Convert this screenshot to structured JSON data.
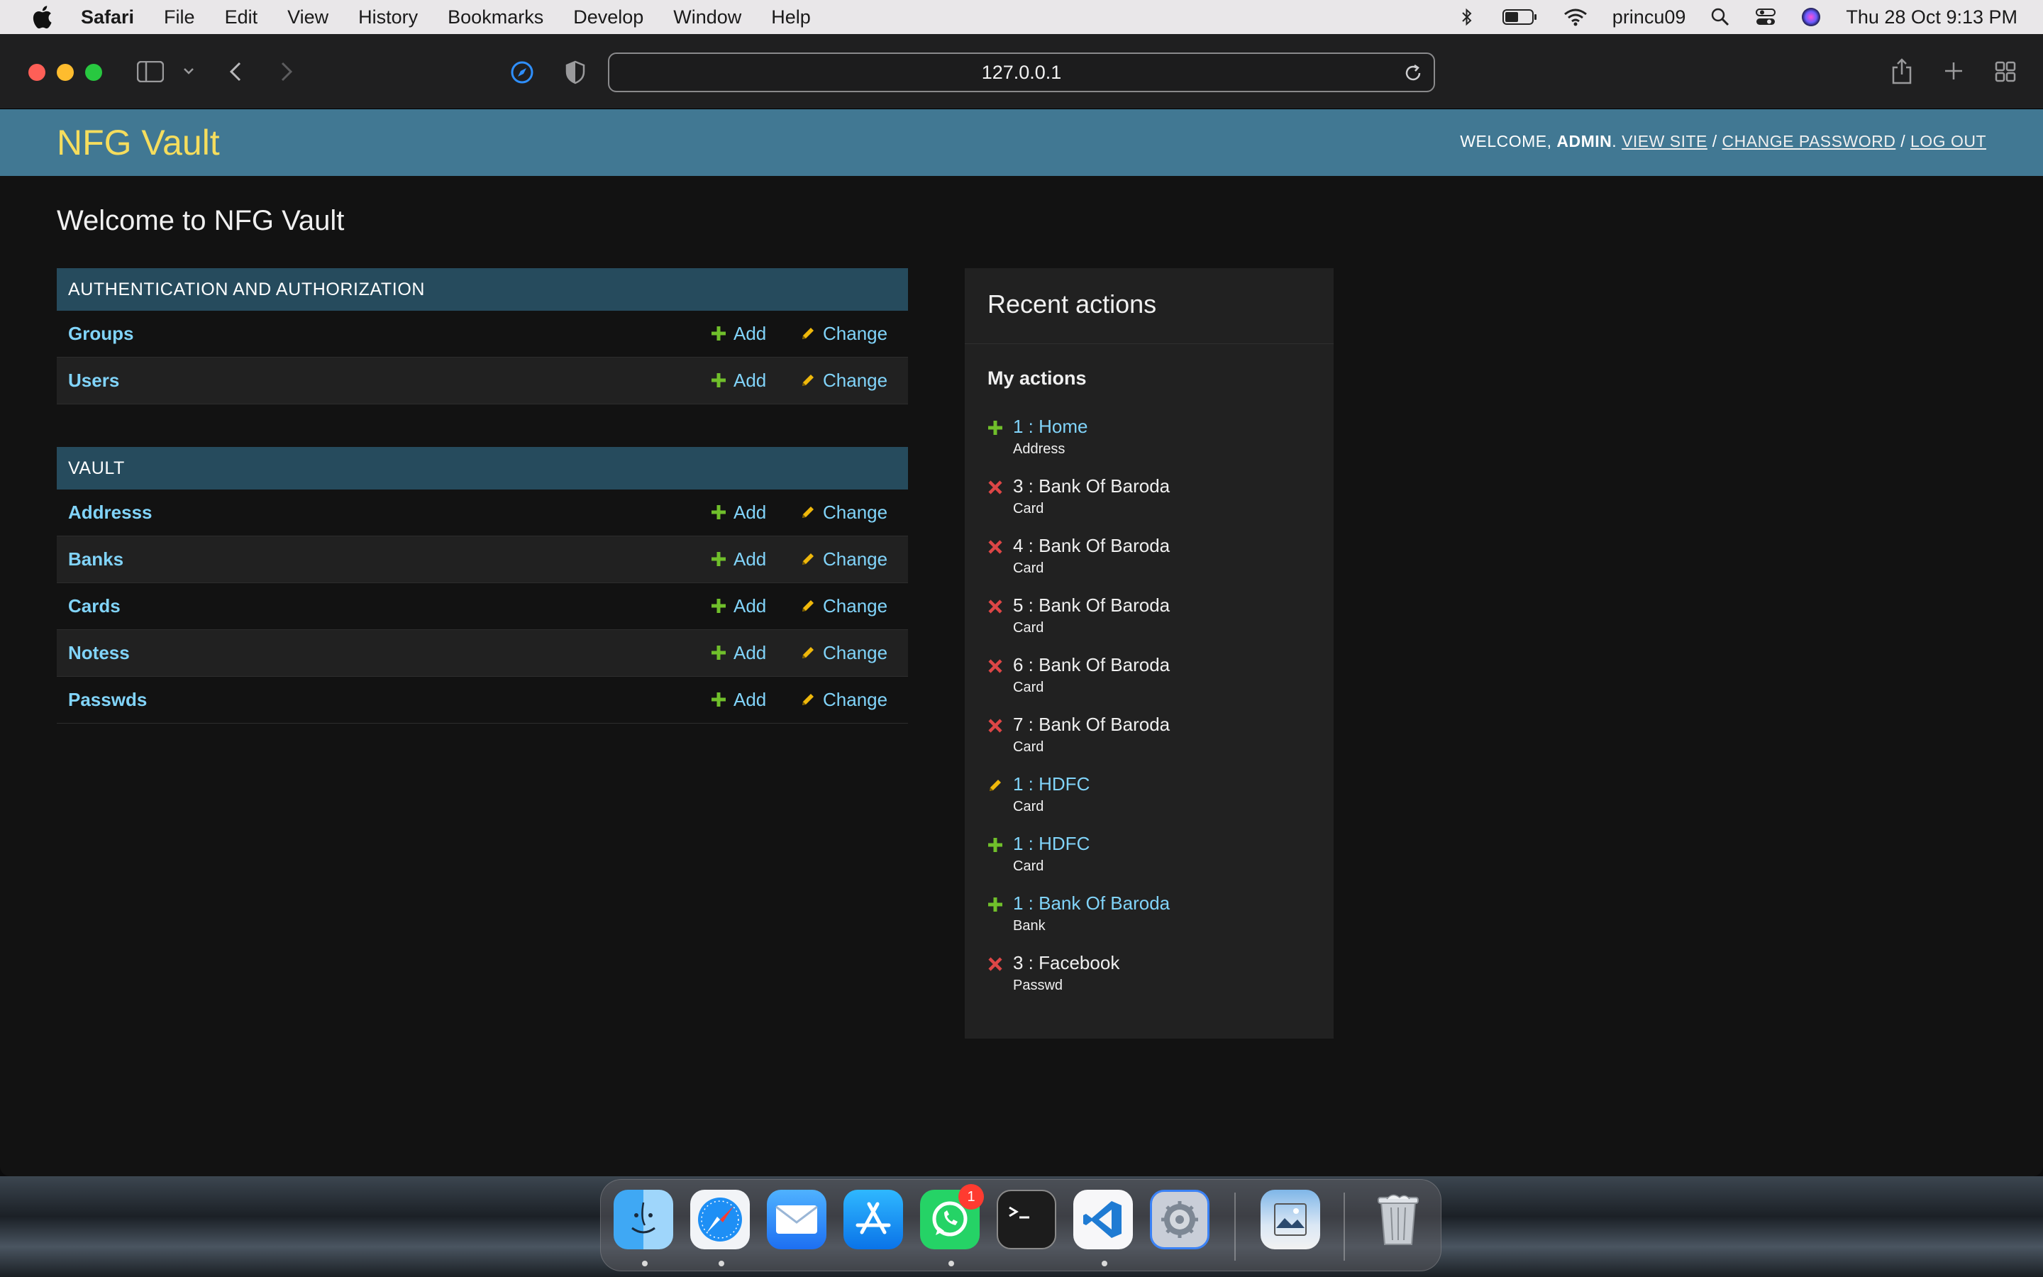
{
  "menubar": {
    "app_name": "Safari",
    "items": [
      "File",
      "Edit",
      "View",
      "History",
      "Bookmarks",
      "Develop",
      "Window",
      "Help"
    ],
    "username": "princu09",
    "datetime": "Thu 28 Oct  9:13 PM"
  },
  "browser": {
    "url": "127.0.0.1"
  },
  "site": {
    "title": "NFG Vault",
    "welcome_prefix": "Welcome,",
    "user": "admin",
    "view_site": "View site",
    "change_password": "Change password",
    "log_out": "Log out",
    "separator": "/"
  },
  "main": {
    "heading": "Welcome to NFG Vault",
    "add_label": "Add",
    "change_label": "Change",
    "modules": [
      {
        "caption": "AUTHENTICATION AND AUTHORIZATION",
        "rows": [
          {
            "name": "Groups"
          },
          {
            "name": "Users"
          }
        ]
      },
      {
        "caption": "VAULT",
        "rows": [
          {
            "name": "Addresss"
          },
          {
            "name": "Banks"
          },
          {
            "name": "Cards"
          },
          {
            "name": "Notess"
          },
          {
            "name": "Passwds"
          }
        ]
      }
    ]
  },
  "recent": {
    "title": "Recent actions",
    "subtitle": "My actions",
    "items": [
      {
        "action": "add",
        "label": "1 : Home",
        "type": "Address"
      },
      {
        "action": "delete",
        "label": "3 : Bank Of Baroda",
        "type": "Card"
      },
      {
        "action": "delete",
        "label": "4 : Bank Of Baroda",
        "type": "Card"
      },
      {
        "action": "delete",
        "label": "5 : Bank Of Baroda",
        "type": "Card"
      },
      {
        "action": "delete",
        "label": "6 : Bank Of Baroda",
        "type": "Card"
      },
      {
        "action": "delete",
        "label": "7 : Bank Of Baroda",
        "type": "Card"
      },
      {
        "action": "change",
        "label": "1 : HDFC",
        "type": "Card"
      },
      {
        "action": "add",
        "label": "1 : HDFC",
        "type": "Card"
      },
      {
        "action": "add",
        "label": "1 : Bank Of Baroda",
        "type": "Bank"
      },
      {
        "action": "delete",
        "label": "3 : Facebook",
        "type": "Passwd"
      }
    ]
  },
  "dock": {
    "apps": [
      "finder-icon",
      "safari-icon",
      "mail-icon",
      "app-store-icon",
      "whatsapp-icon",
      "terminal-icon",
      "vscode-icon",
      "system-preferences-icon",
      "preview-icon",
      "trash-icon"
    ],
    "whatsapp_badge": "1"
  },
  "colors": {
    "header_bg": "#417893",
    "title_yellow": "#f5dd5d",
    "caption_bg": "#264b5d",
    "link": "#81d4fa",
    "add_green": "#70bf2b",
    "change_yellow": "#efb80b",
    "delete_red": "#dd4646"
  }
}
